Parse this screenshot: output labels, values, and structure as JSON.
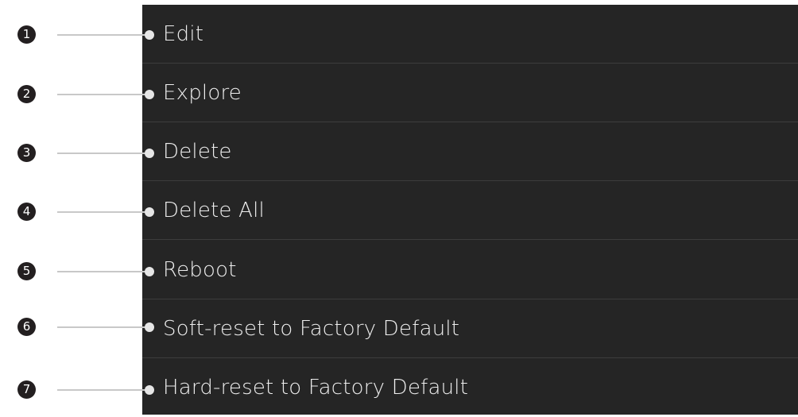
{
  "menu": {
    "items": [
      {
        "number": "1",
        "label": "Edit"
      },
      {
        "number": "2",
        "label": "Explore"
      },
      {
        "number": "3",
        "label": "Delete"
      },
      {
        "number": "4",
        "label": "Delete All"
      },
      {
        "number": "5",
        "label": "Reboot"
      },
      {
        "number": "6",
        "label": "Soft-reset to Factory Default"
      },
      {
        "number": "7",
        "label": "Hard-reset to Factory Default"
      }
    ]
  },
  "colors": {
    "panel_background": "#252525",
    "divider": "#3d3d3d",
    "label_text": "#eeeeee",
    "badge": "#231f20",
    "leader_line": "#c8c8c8",
    "leader_dot": "#e6e6e6"
  }
}
